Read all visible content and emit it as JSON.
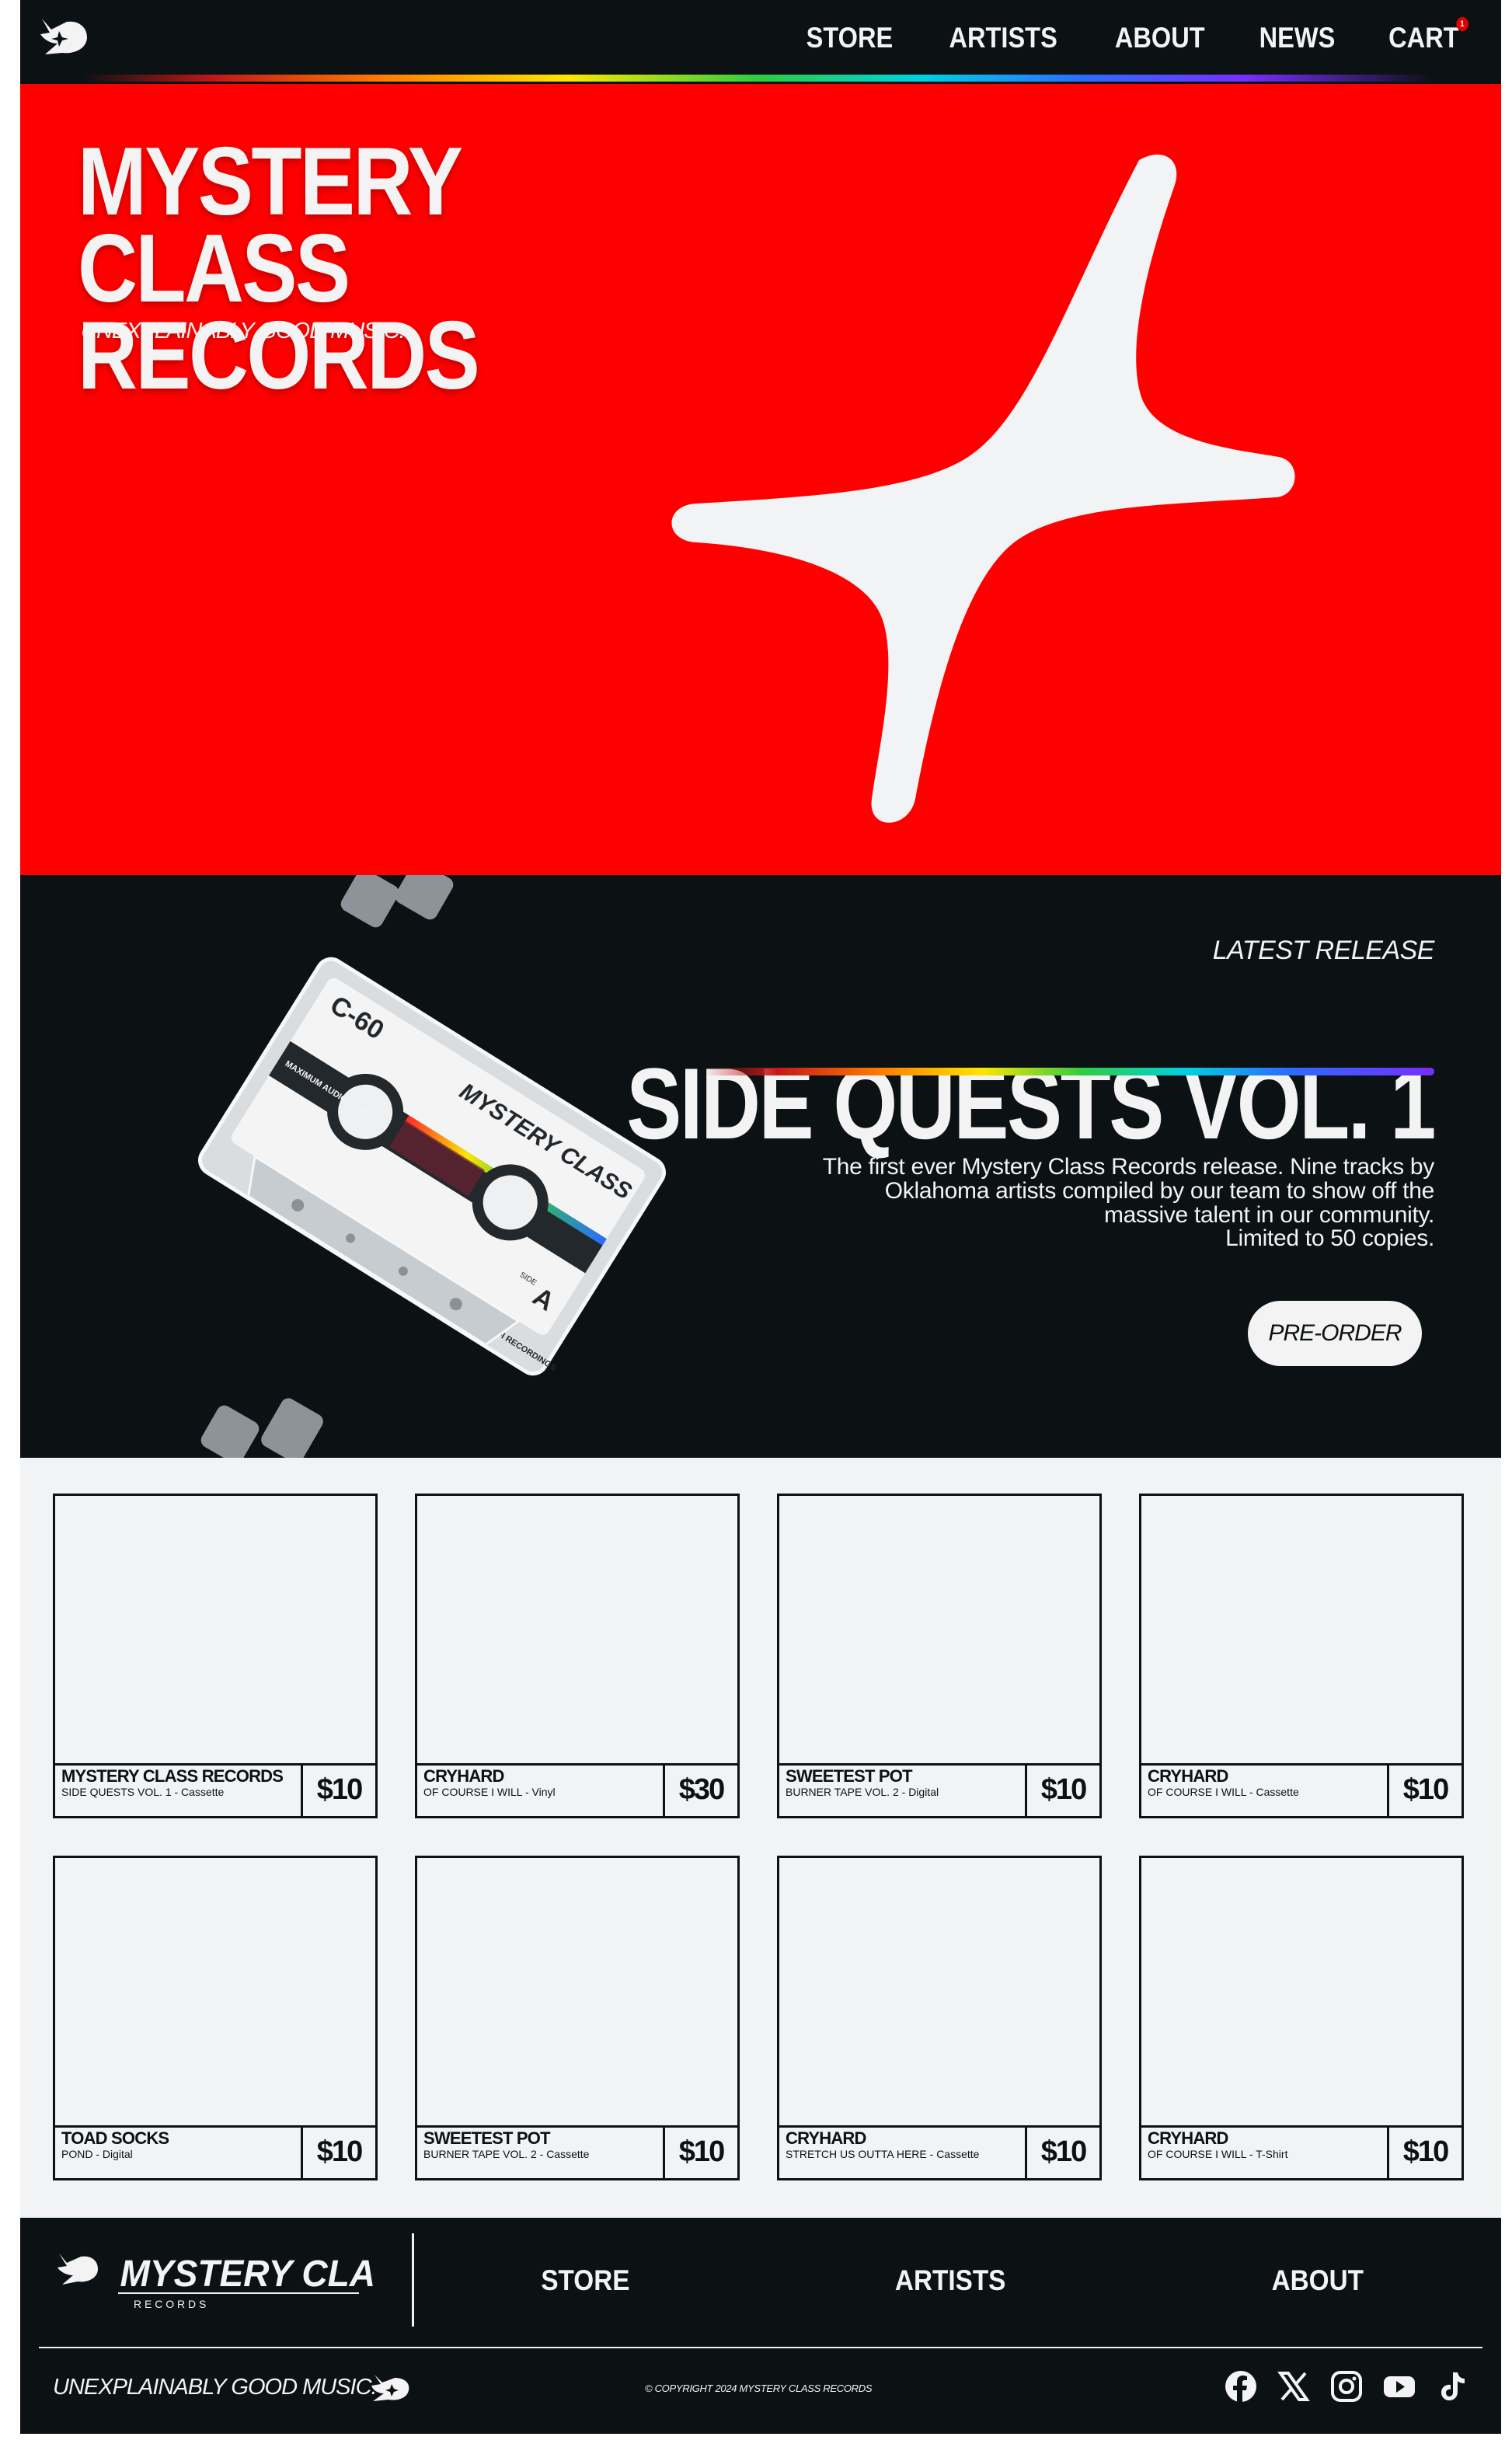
{
  "nav": {
    "links": [
      "STORE",
      "ARTISTS",
      "ABOUT",
      "NEWS"
    ],
    "cart_label": "CART",
    "cart_count": "1"
  },
  "hero": {
    "title_line1": "MYSTERY CLASS",
    "title_line2": "RECORDS",
    "tagline": "UNEXPLAINABLY GOOD MUSIC."
  },
  "release": {
    "label": "LATEST RELEASE",
    "title": "SIDE QUESTS VOL. 1",
    "description": "The first ever Mystery Class Records release. Nine tracks by Oklahoma artists compiled by our team to show off the massive talent in our community.",
    "limited": "Limited to 50 copies.",
    "button": "PRE-ORDER",
    "cassette_text": {
      "length": "C-60",
      "brand": "MYSTERY CLASS",
      "side": "A",
      "side_label": "SIDE",
      "tape_type": "MAXIMUM AUDIO POWER",
      "footer_text": "SUPERIOR HI-FI RECORDINGS"
    }
  },
  "store": {
    "products": [
      {
        "artist": "MYSTERY CLASS RECORDS",
        "item": "SIDE QUESTS VOL. 1 - Cassette",
        "price": "$10"
      },
      {
        "artist": "CRYHARD",
        "item": "OF COURSE I WILL - Vinyl",
        "price": "$30"
      },
      {
        "artist": "SWEETEST POT",
        "item": "BURNER TAPE VOL. 2 - Digital",
        "price": "$10"
      },
      {
        "artist": "CRYHARD",
        "item": "OF COURSE I WILL - Cassette",
        "price": "$10"
      },
      {
        "artist": "TOAD SOCKS",
        "item": "POND - Digital",
        "price": "$10"
      },
      {
        "artist": "SWEETEST POT",
        "item": "BURNER TAPE VOL. 2 - Cassette",
        "price": "$10"
      },
      {
        "artist": "CRYHARD",
        "item": "STRETCH US OUTTA HERE - Cassette",
        "price": "$10"
      },
      {
        "artist": "CRYHARD",
        "item": "OF COURSE I WILL - T-Shirt",
        "price": "$10"
      }
    ]
  },
  "footer": {
    "logo_text": "MYSTERY CLASS",
    "logo_sub": "R E C O R D S",
    "links": [
      "STORE",
      "ARTISTS",
      "ABOUT"
    ],
    "tagline": "UNEXPLAINABLY GOOD MUSIC.",
    "copyright": "© COPYRIGHT 2024 MYSTERY CLASS RECORDS",
    "socials": [
      "facebook-icon",
      "x-icon",
      "instagram-icon",
      "youtube-icon",
      "tiktok-icon"
    ]
  },
  "colors": {
    "background_dark": "#0c1114",
    "hero_red": "#ff0000",
    "off_white": "#f3f3f4",
    "store_bg": "#f2f3f5"
  }
}
